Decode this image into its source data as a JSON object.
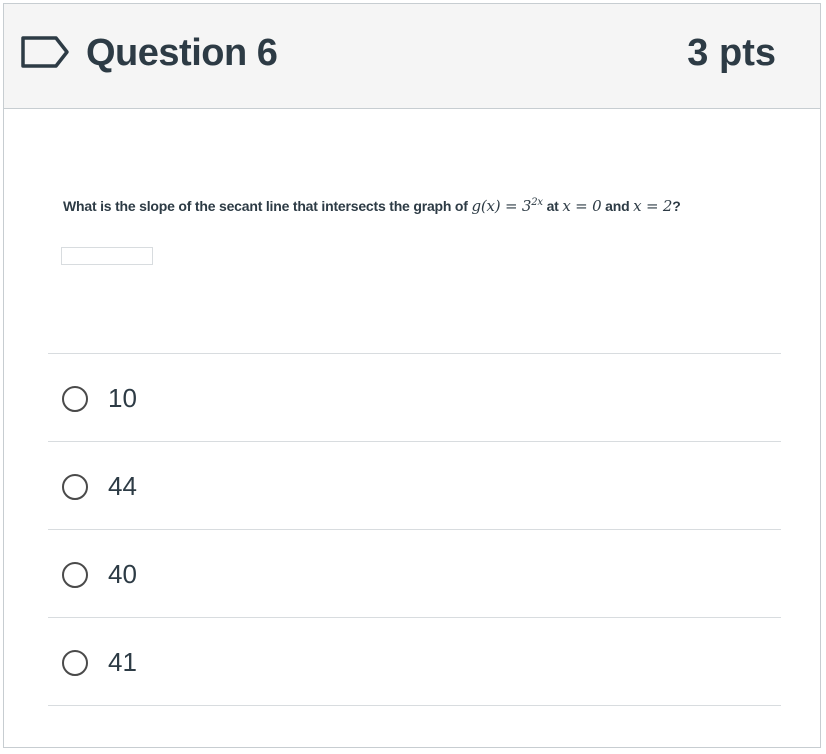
{
  "header": {
    "title": "Question 6",
    "points": "3 pts",
    "flag_icon": "bookmark-flag-icon"
  },
  "question": {
    "prefix": "What is the slope of the secant line that intersects the graph of",
    "func_lhs": "g(x) = 3",
    "func_exp": "2x",
    "at_text": "at",
    "x1": "x = 0",
    "and_text": "and",
    "x2": "x = 2",
    "suffix": "?"
  },
  "answers": [
    {
      "label": "10"
    },
    {
      "label": "44"
    },
    {
      "label": "40"
    },
    {
      "label": "41"
    }
  ],
  "colors": {
    "text": "#2d3b45",
    "header_bg": "#f5f5f5",
    "border": "#c7cdd1",
    "flag": "#2d3b45"
  }
}
